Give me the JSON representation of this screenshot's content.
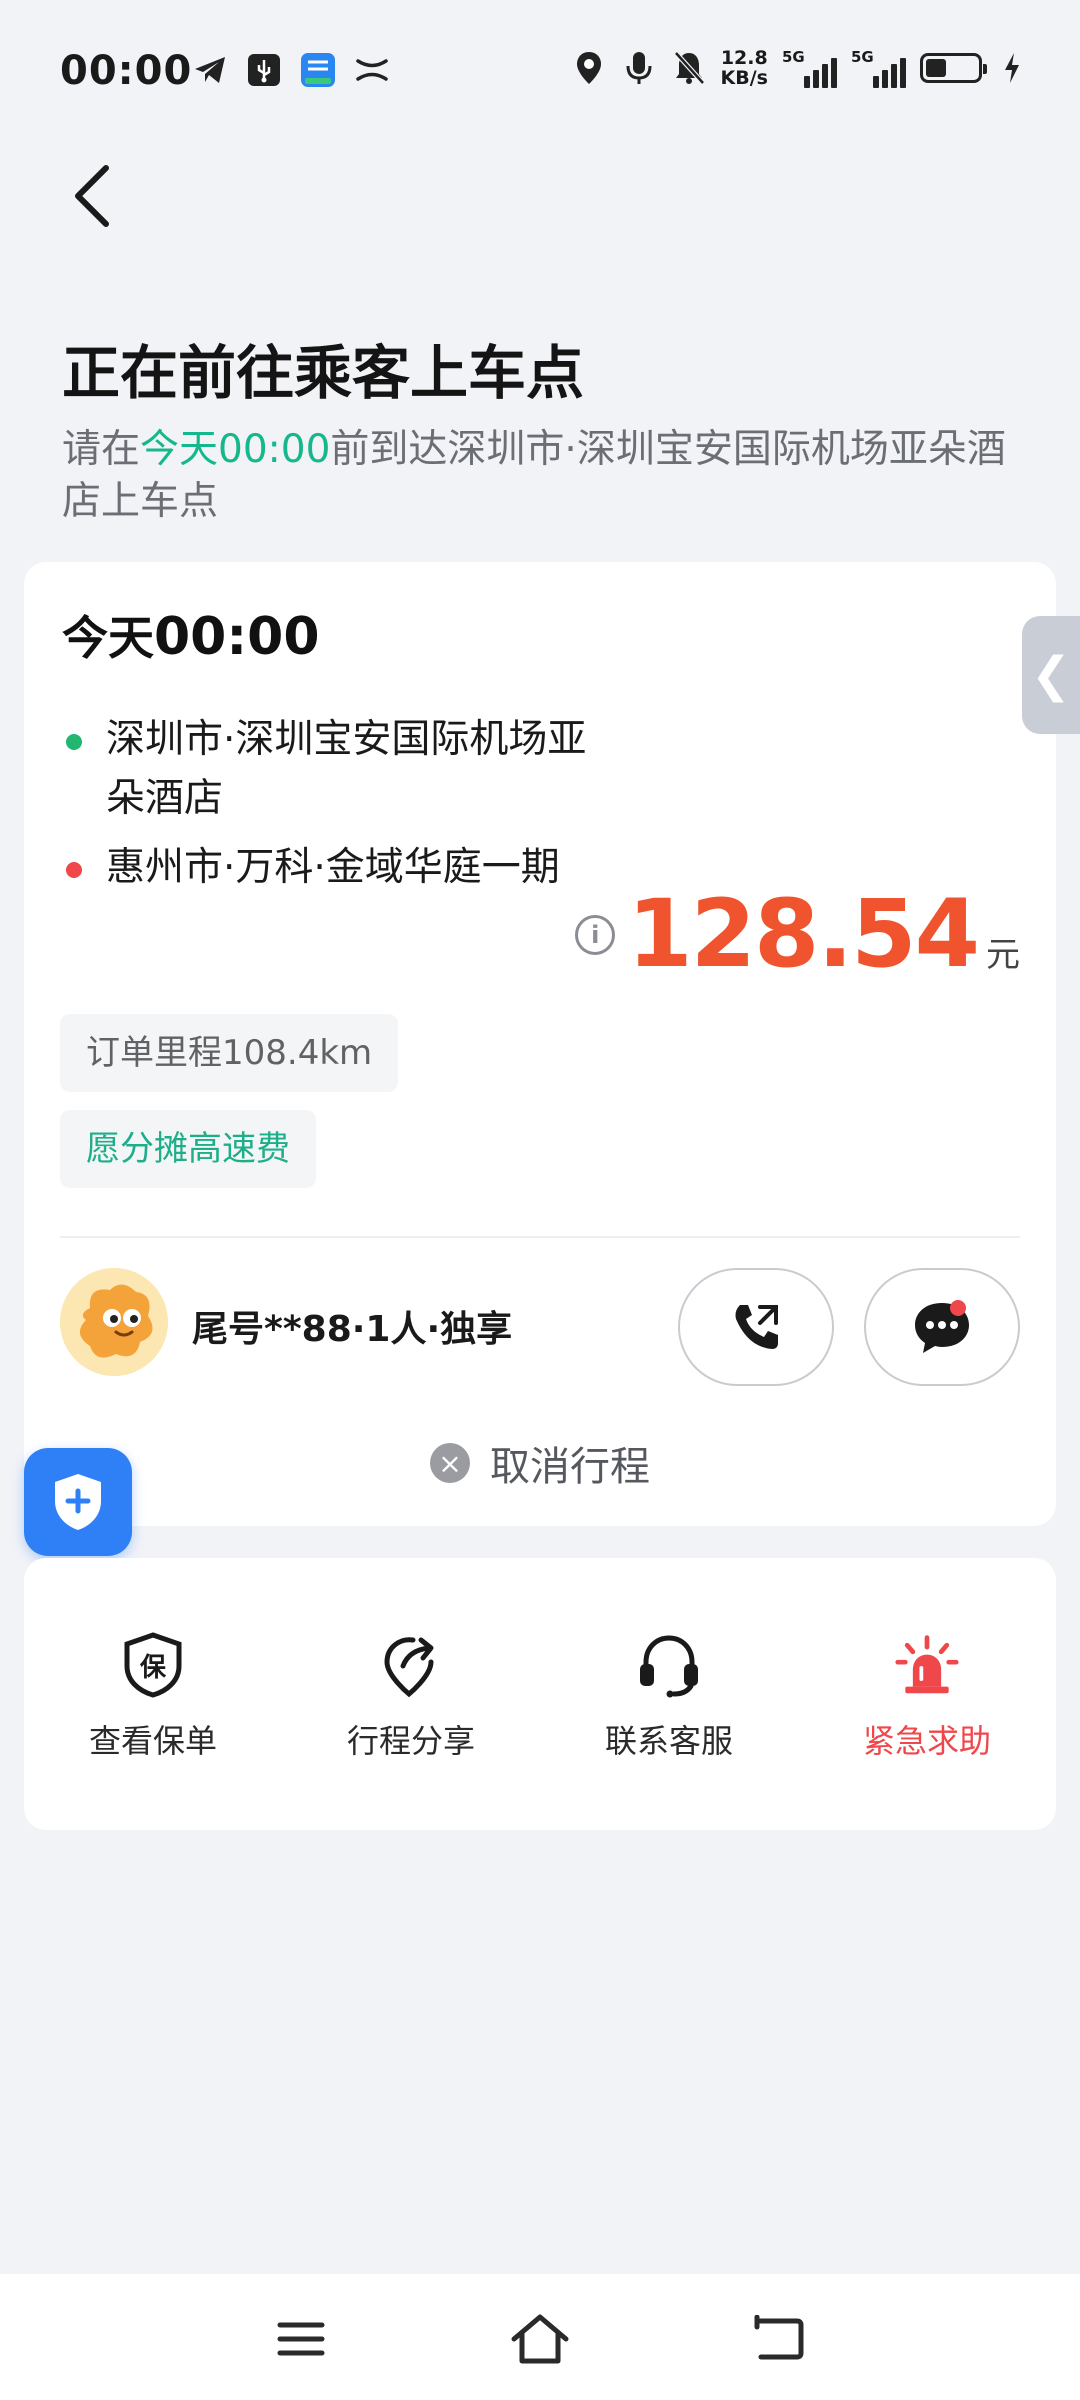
{
  "status_bar": {
    "time": "00:00",
    "net_speed_value": "12.8",
    "net_speed_unit": "KB/s",
    "signal_tag_1": "5G",
    "signal_tag_2": "5G",
    "left_icons": [
      "telegram-icon",
      "usb-debug-icon",
      "app-notification-icon",
      "x-app-icon"
    ],
    "right_icons": [
      "location-icon",
      "mic-icon",
      "bell-off-icon",
      "signal-icon",
      "signal-icon",
      "battery-icon",
      "charging-icon"
    ]
  },
  "header": {
    "title": "正在前往乘客上车点",
    "subtitle_prefix": "请在",
    "subtitle_time": "今天00:00",
    "subtitle_suffix": "前到达深圳市·深圳宝安国际机场亚朵酒店上车点"
  },
  "order": {
    "day": "今天",
    "time": "00:00",
    "pickup": "深圳市·深圳宝安国际机场亚朵酒店",
    "dropoff": "惠州市·万科·金域华庭一期",
    "price": "128.54",
    "price_unit": "元",
    "distance": "订单里程108.4km",
    "toll_note": "愿分摊高速费",
    "passenger": "尾号**88·1人·独享",
    "cancel_label": "取消行程"
  },
  "actions": [
    {
      "label": "查看保单",
      "icon": "policy-icon"
    },
    {
      "label": "行程分享",
      "icon": "share-trip-icon"
    },
    {
      "label": "联系客服",
      "icon": "headset-icon"
    },
    {
      "label": "紧急求助",
      "icon": "alarm-icon"
    }
  ],
  "icon_text": {
    "policy_glyph": "保",
    "info_glyph": "i",
    "cancel_glyph": "×",
    "side_tab_glyph": "❮"
  },
  "colors": {
    "accent_green": "#15B88C",
    "price_orange": "#F0542E",
    "alert_red": "#F0474A",
    "shield_blue": "#2F80F6"
  }
}
